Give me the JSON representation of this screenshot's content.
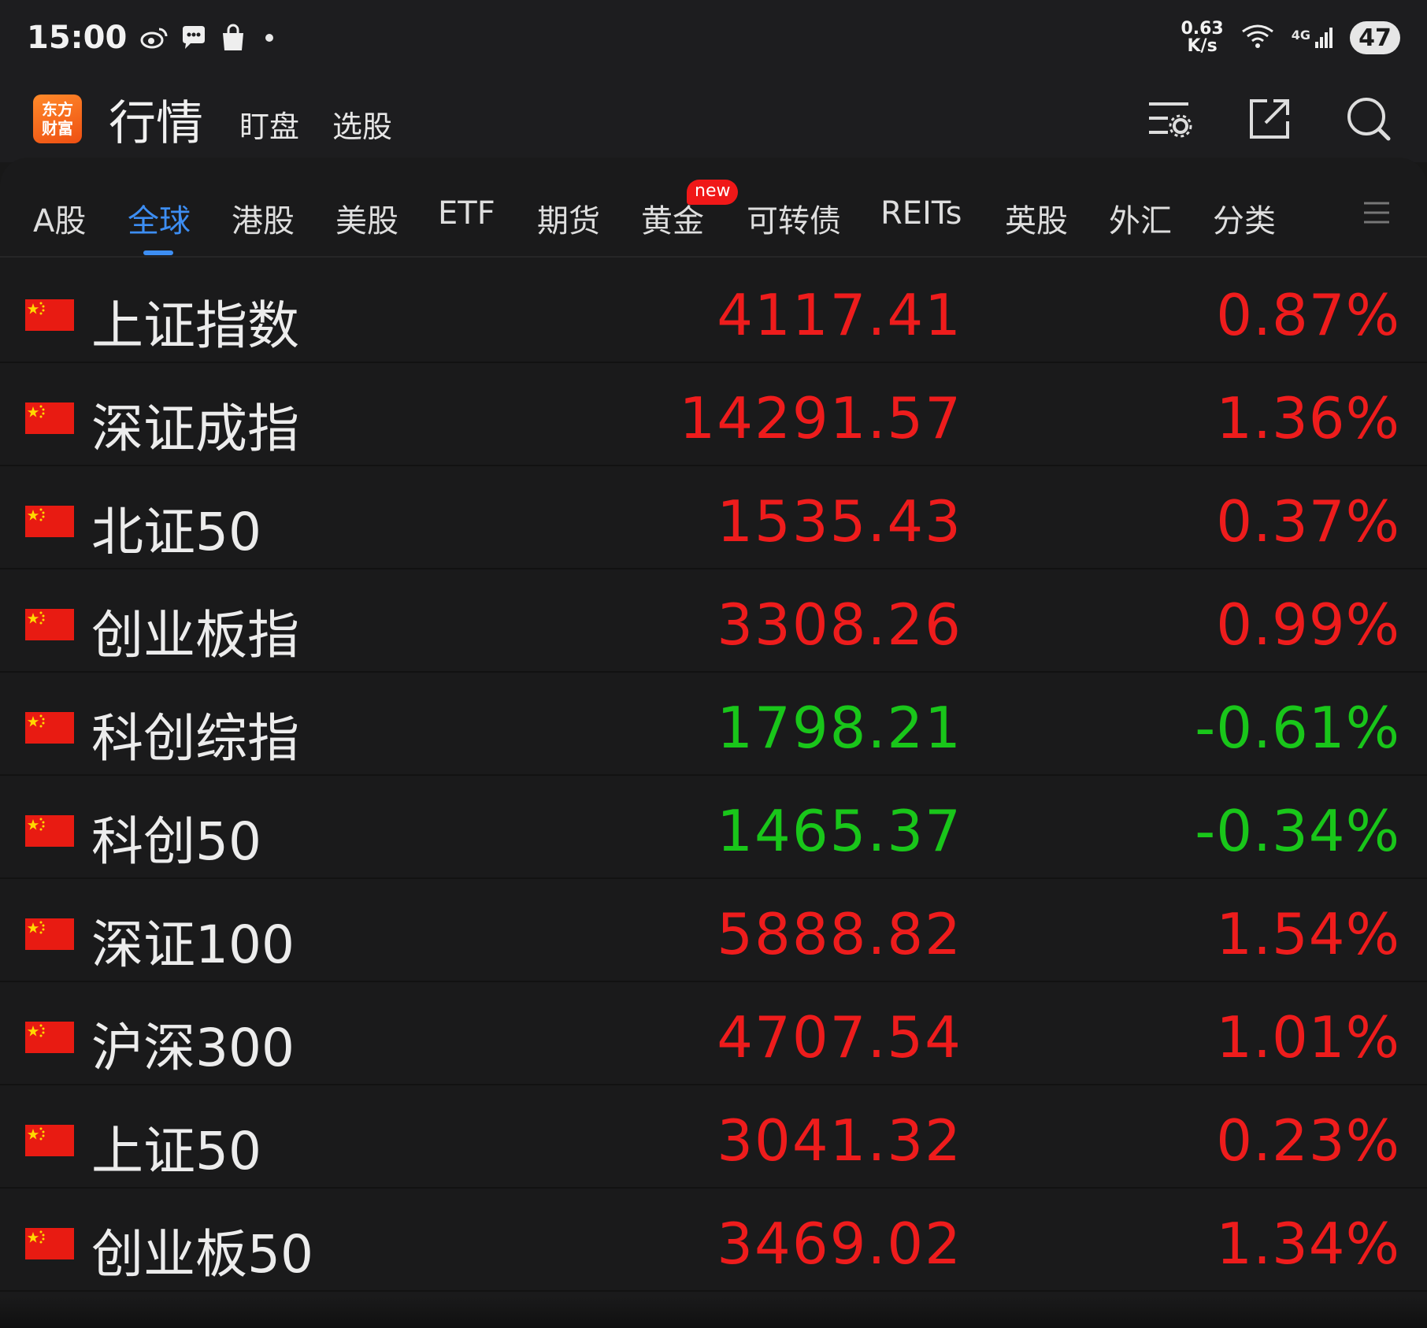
{
  "status_bar": {
    "time": "15:00",
    "net_speed_value": "0.63",
    "net_speed_unit": "K/s",
    "network_type": "4G",
    "battery": "47"
  },
  "header": {
    "logo_line1": "东方",
    "logo_line2": "财富",
    "title": "行情",
    "tabs": [
      "盯盘",
      "选股"
    ]
  },
  "market_tabs": {
    "items": [
      "A股",
      "全球",
      "港股",
      "美股",
      "ETF",
      "期货",
      "黄金",
      "可转债",
      "REITs",
      "英股",
      "外汇",
      "分类"
    ],
    "active": "全球",
    "new_badge": "new"
  },
  "indices": [
    {
      "name": "上证指数",
      "price": "4117.41",
      "change": "0.87%",
      "direction": "up"
    },
    {
      "name": "深证成指",
      "price": "14291.57",
      "change": "1.36%",
      "direction": "up"
    },
    {
      "name": "北证50",
      "price": "1535.43",
      "change": "0.37%",
      "direction": "up"
    },
    {
      "name": "创业板指",
      "price": "3308.26",
      "change": "0.99%",
      "direction": "up"
    },
    {
      "name": "科创综指",
      "price": "1798.21",
      "change": "-0.61%",
      "direction": "down"
    },
    {
      "name": "科创50",
      "price": "1465.37",
      "change": "-0.34%",
      "direction": "down"
    },
    {
      "name": "深证100",
      "price": "5888.82",
      "change": "1.54%",
      "direction": "up"
    },
    {
      "name": "沪深300",
      "price": "4707.54",
      "change": "1.01%",
      "direction": "up"
    },
    {
      "name": "上证50",
      "price": "3041.32",
      "change": "0.23%",
      "direction": "up"
    },
    {
      "name": "创业板50",
      "price": "3469.02",
      "change": "1.34%",
      "direction": "up"
    }
  ],
  "colors": {
    "up": "#ee1c1c",
    "down": "#19c61a",
    "accent": "#3d8ef3",
    "logo": "#ee4f12"
  },
  "icons": {
    "status": [
      "weibo-icon",
      "chat-bubble-icon",
      "shopping-bag-icon",
      "wifi-icon",
      "signal-icon"
    ],
    "header_actions": [
      "list-settings-icon",
      "share-external-icon",
      "search-icon"
    ],
    "row_flag": "china-flag-icon",
    "tabs_menu": "hamburger-menu-icon"
  }
}
